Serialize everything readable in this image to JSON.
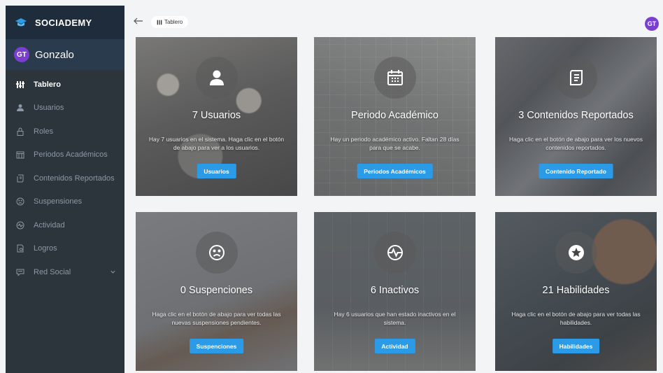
{
  "brand": {
    "name": "SOCIADEMY"
  },
  "user": {
    "initials": "GT",
    "name": "Gonzalo"
  },
  "nav": [
    {
      "label": "Tablero",
      "icon": "dashboard-icon",
      "active": true
    },
    {
      "label": "Usuarios",
      "icon": "user-icon"
    },
    {
      "label": "Roles",
      "icon": "lock-icon"
    },
    {
      "label": "Periodos Académicos",
      "icon": "calendar-icon"
    },
    {
      "label": "Contenidos Reportados",
      "icon": "document-icon"
    },
    {
      "label": "Suspensiones",
      "icon": "sad-face-icon"
    },
    {
      "label": "Actividad",
      "icon": "activity-icon"
    },
    {
      "label": "Logros",
      "icon": "award-icon"
    },
    {
      "label": "Red Social",
      "icon": "social-icon",
      "has_submenu": true
    }
  ],
  "topbar": {
    "breadcrumb": "Tablero",
    "avatar_initials": "GT"
  },
  "cards": [
    {
      "title": "7 Usuarios",
      "description": "Hay 7 usuarios en el sistema. Haga clic en el botón de abajo para ver a los usuarios.",
      "button": "Usuarios",
      "icon": "user-icon"
    },
    {
      "title": "Periodo Académico",
      "description": "Hay un periodo académico activo. Faltan 28 días para que se acabe.",
      "button": "Periodos Académicos",
      "icon": "calendar-icon"
    },
    {
      "title": "3 Contenidos Reportados",
      "description": "Haga clic en el botón de abajo para ver los nuevos contenidos reportados.",
      "button": "Contenido Reportado",
      "icon": "document-icon"
    },
    {
      "title": "0 Suspenciones",
      "description": "Haga clic en el botón de abajo para ver todas las nuevas suspensiones pendientes.",
      "button": "Suspenciones",
      "icon": "sad-face-icon"
    },
    {
      "title": "6 Inactivos",
      "description": "Hay 6 usuarios que han estado inactivos en el sistema.",
      "button": "Actividad",
      "icon": "activity-icon"
    },
    {
      "title": "21 Habilidades",
      "description": "Haga clic en el botón de abajo para ver todas las habilidades.",
      "button": "Habilidades",
      "icon": "star-icon"
    }
  ],
  "colors": {
    "sidebar": "#2c343c",
    "brand_bar": "#1f2c3c",
    "accent_button": "#2b9be8",
    "avatar": "#7b3fd0"
  }
}
